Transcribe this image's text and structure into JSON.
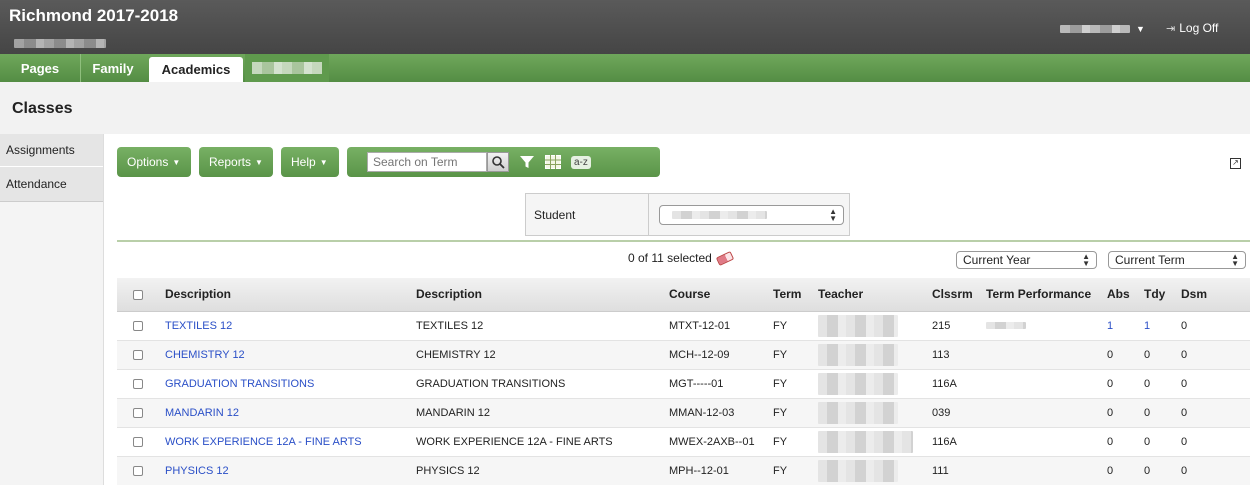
{
  "header": {
    "school_title": "Richmond 2017-2018",
    "logoff_label": "Log Off"
  },
  "tabs": [
    {
      "label": "Pages"
    },
    {
      "label": "Family"
    },
    {
      "label": "Academics"
    }
  ],
  "page": {
    "title": "Classes"
  },
  "sidenav": {
    "items": [
      {
        "label": "Assignments"
      },
      {
        "label": "Attendance"
      }
    ]
  },
  "toolbar": {
    "options_label": "Options",
    "reports_label": "Reports",
    "help_label": "Help",
    "search_placeholder": "Search on Term",
    "az_label": "a-z"
  },
  "student": {
    "label": "Student"
  },
  "selection": {
    "text": "0 of 11 selected",
    "year_filter": "Current Year",
    "term_filter": "Current Term"
  },
  "table": {
    "headers": [
      "Description",
      "Description",
      "Course",
      "Term",
      "Teacher",
      "Clssrm",
      "Term Performance",
      "Abs",
      "Tdy",
      "Dsm"
    ],
    "rows": [
      {
        "desc": "TEXTILES 12",
        "desc2": "TEXTILES 12",
        "course": "MTXT-12-01",
        "term": "FY",
        "room": "215",
        "abs": "1",
        "tdy": "1",
        "dsm": "0"
      },
      {
        "desc": "CHEMISTRY 12",
        "desc2": "CHEMISTRY 12",
        "course": "MCH--12-09",
        "term": "FY",
        "room": "113",
        "abs": "0",
        "tdy": "0",
        "dsm": "0"
      },
      {
        "desc": "GRADUATION TRANSITIONS",
        "desc2": "GRADUATION TRANSITIONS",
        "course": "MGT-----01",
        "term": "FY",
        "room": "116A",
        "abs": "0",
        "tdy": "0",
        "dsm": "0"
      },
      {
        "desc": "MANDARIN 12",
        "desc2": "MANDARIN 12",
        "course": "MMAN-12-03",
        "term": "FY",
        "room": "039",
        "abs": "0",
        "tdy": "0",
        "dsm": "0"
      },
      {
        "desc": "WORK EXPERIENCE 12A - FINE ARTS",
        "desc2": "WORK EXPERIENCE 12A - FINE ARTS",
        "course": "MWEX-2AXB--01",
        "term": "FY",
        "room": "116A",
        "abs": "0",
        "tdy": "0",
        "dsm": "0"
      },
      {
        "desc": "PHYSICS 12",
        "desc2": "PHYSICS 12",
        "course": "MPH--12-01",
        "term": "FY",
        "room": "111",
        "abs": "0",
        "tdy": "0",
        "dsm": "0"
      }
    ]
  },
  "icons": {
    "search": "magnifier-icon",
    "filter": "funnel-icon",
    "columns": "grid-icon",
    "sort": "az-icon",
    "clear": "eraser-icon",
    "popout": "popout-icon"
  }
}
